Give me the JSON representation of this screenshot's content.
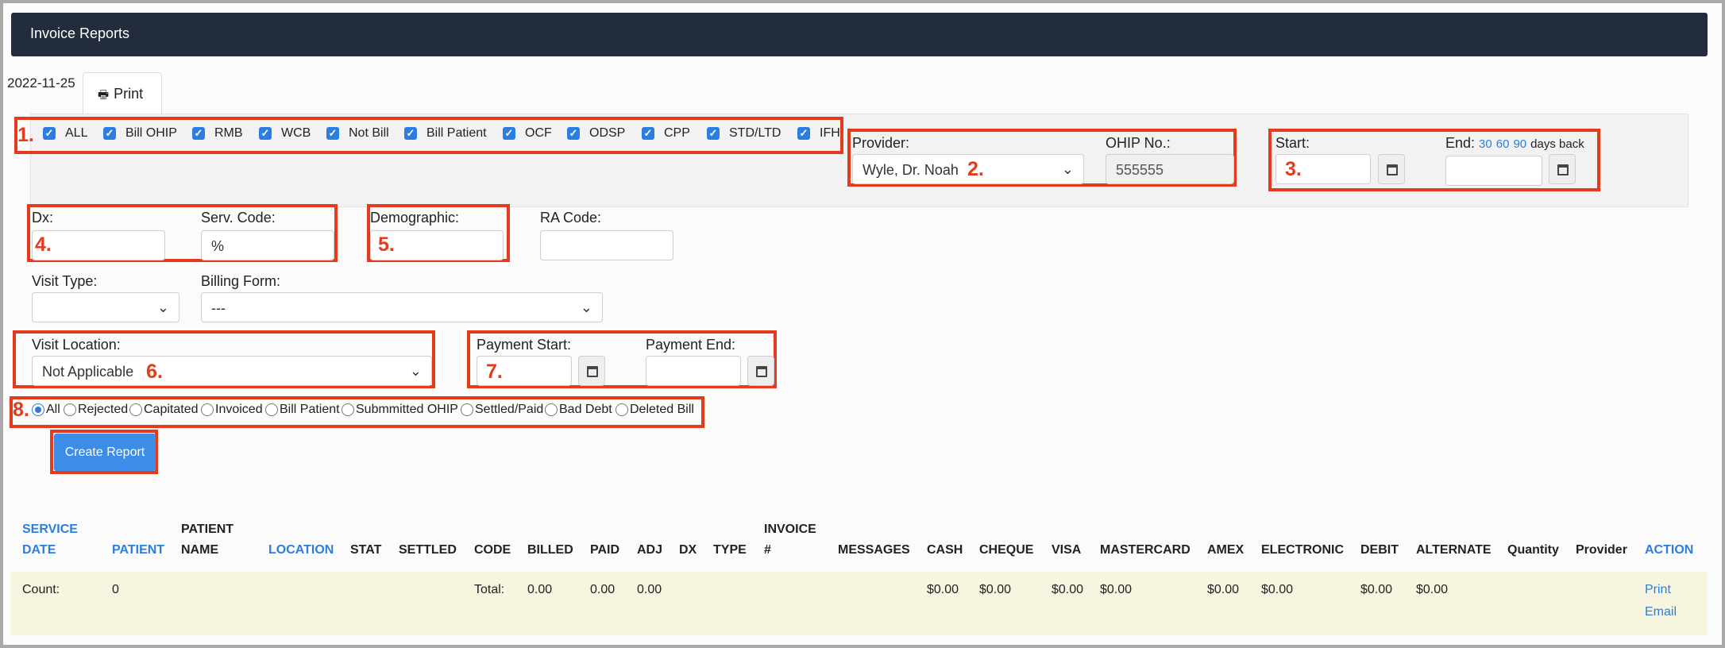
{
  "header": {
    "title": "Invoice Reports"
  },
  "date": "2022-11-25",
  "print_button": {
    "label": "Print",
    "icon": "printer-icon"
  },
  "annotations": [
    "1.",
    "2.",
    "3.",
    "4.",
    "5.",
    "6.",
    "7.",
    "8."
  ],
  "billing_types": [
    "ALL",
    "Bill OHIP",
    "RMB",
    "WCB",
    "Not Bill",
    "Bill Patient",
    "OCF",
    "ODSP",
    "CPP",
    "STD/LTD",
    "IFH"
  ],
  "provider": {
    "label": "Provider:",
    "value": "Wyle, Dr. Noah"
  },
  "ohip": {
    "label": "OHIP No.:",
    "value": "555555"
  },
  "start": {
    "label": "Start:",
    "value": ""
  },
  "end": {
    "label": "End:",
    "shortcuts": [
      "30",
      "60",
      "90"
    ],
    "suffix": "days back",
    "value": ""
  },
  "dx": {
    "label": "Dx:",
    "value": ""
  },
  "serv_code": {
    "label": "Serv. Code:",
    "value": "%"
  },
  "demographic": {
    "label": "Demographic:",
    "value": ""
  },
  "ra_code": {
    "label": "RA Code:",
    "value": ""
  },
  "visit_type": {
    "label": "Visit Type:",
    "value": ""
  },
  "billing_form": {
    "label": "Billing Form:",
    "value": "---"
  },
  "visit_location": {
    "label": "Visit Location:",
    "value": "Not Applicable"
  },
  "payment_start": {
    "label": "Payment Start:",
    "value": ""
  },
  "payment_end": {
    "label": "Payment End:",
    "value": ""
  },
  "status_options": [
    "All",
    "Rejected",
    "Capitated",
    "Invoiced",
    "Bill Patient",
    "Submmitted OHIP",
    "Settled/Paid",
    "Bad Debt",
    "Deleted Bill"
  ],
  "status_selected": "All",
  "create_report": "Create Report",
  "table": {
    "columns": [
      {
        "top": "SERVICE",
        "bottom": "DATE",
        "sortable": true
      },
      {
        "top": "",
        "bottom": "PATIENT",
        "sortable": true
      },
      {
        "top": "PATIENT",
        "bottom": "NAME",
        "sortable": false
      },
      {
        "top": "",
        "bottom": "LOCATION",
        "sortable": true
      },
      {
        "top": "",
        "bottom": "STAT",
        "sortable": false
      },
      {
        "top": "",
        "bottom": "SETTLED",
        "sortable": false
      },
      {
        "top": "",
        "bottom": "CODE",
        "sortable": false
      },
      {
        "top": "",
        "bottom": "BILLED",
        "sortable": false
      },
      {
        "top": "",
        "bottom": "PAID",
        "sortable": false
      },
      {
        "top": "",
        "bottom": "ADJ",
        "sortable": false
      },
      {
        "top": "",
        "bottom": "DX",
        "sortable": false
      },
      {
        "top": "",
        "bottom": "TYPE",
        "sortable": false
      },
      {
        "top": "INVOICE",
        "bottom": "#",
        "sortable": false
      },
      {
        "top": "",
        "bottom": "MESSAGES",
        "sortable": false
      },
      {
        "top": "",
        "bottom": "CASH",
        "sortable": false
      },
      {
        "top": "",
        "bottom": "CHEQUE",
        "sortable": false
      },
      {
        "top": "",
        "bottom": "VISA",
        "sortable": false
      },
      {
        "top": "",
        "bottom": "MASTERCARD",
        "sortable": false
      },
      {
        "top": "",
        "bottom": "AMEX",
        "sortable": false
      },
      {
        "top": "",
        "bottom": "ELECTRONIC",
        "sortable": false
      },
      {
        "top": "",
        "bottom": "DEBIT",
        "sortable": false
      },
      {
        "top": "",
        "bottom": "ALTERNATE",
        "sortable": false
      },
      {
        "top": "",
        "bottom": "Quantity",
        "sortable": false
      },
      {
        "top": "",
        "bottom": "Provider",
        "sortable": false
      },
      {
        "top": "",
        "bottom": "ACTION",
        "sortable": true
      }
    ],
    "totals_row": {
      "count_label": "Count:",
      "count": "0",
      "total_label": "Total:",
      "billed": "0.00",
      "paid": "0.00",
      "adj": "0.00",
      "cash": "$0.00",
      "cheque": "$0.00",
      "visa": "$0.00",
      "mastercard": "$0.00",
      "amex": "$0.00",
      "electronic": "$0.00",
      "debit": "$0.00",
      "alternate": "$0.00",
      "actions": [
        "Print",
        "Email"
      ]
    }
  },
  "colors": {
    "header_bg": "#232c3d",
    "accent": "#2a7de1",
    "annotation_red": "#e63a1c",
    "totals_bg": "#f7f4df"
  }
}
